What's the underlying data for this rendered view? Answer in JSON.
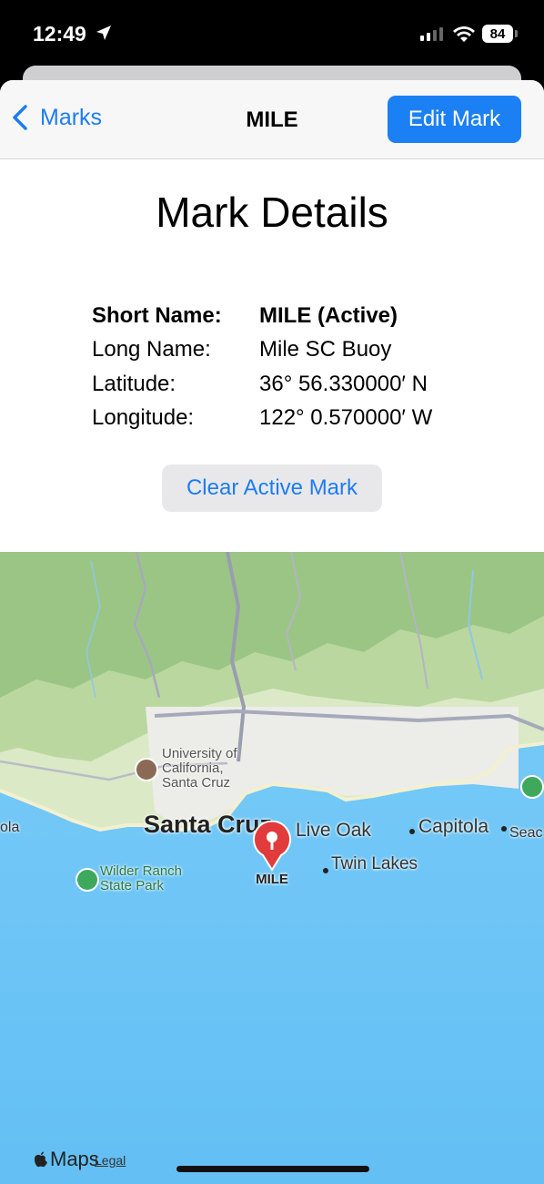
{
  "status_bar": {
    "time": "12:49",
    "battery": "84"
  },
  "nav": {
    "back_label": "Marks",
    "title": "MILE",
    "edit_label": "Edit Mark"
  },
  "heading": "Mark Details",
  "details": [
    {
      "label": "Short Name:",
      "value": "MILE (Active)"
    },
    {
      "label": "Long Name:",
      "value": "Mile SC Buoy"
    },
    {
      "label": "Latitude:",
      "value": "36° 56.330000′ N"
    },
    {
      "label": "Longitude:",
      "value": "122° 0.570000′ W"
    }
  ],
  "clear_button": "Clear Active Mark",
  "map": {
    "labels": {
      "university": "University of\nCalifornia,\nSanta Cruz",
      "santa_cruz": "Santa Cruz",
      "live_oak": "Live Oak",
      "capitola": "Capitola",
      "seacliff": "Seac",
      "left_edge": "ola",
      "twin_lakes": "Twin Lakes",
      "wilder_ranch": "Wilder Ranch\nState Park",
      "pin": "MILE"
    },
    "attribution": {
      "maps": "Maps",
      "legal": "Legal"
    }
  },
  "colors": {
    "accent": "#1b80f3",
    "pin": "#e23b3b",
    "ocean": "#6cc4f5",
    "land": "#dbe9c6"
  }
}
